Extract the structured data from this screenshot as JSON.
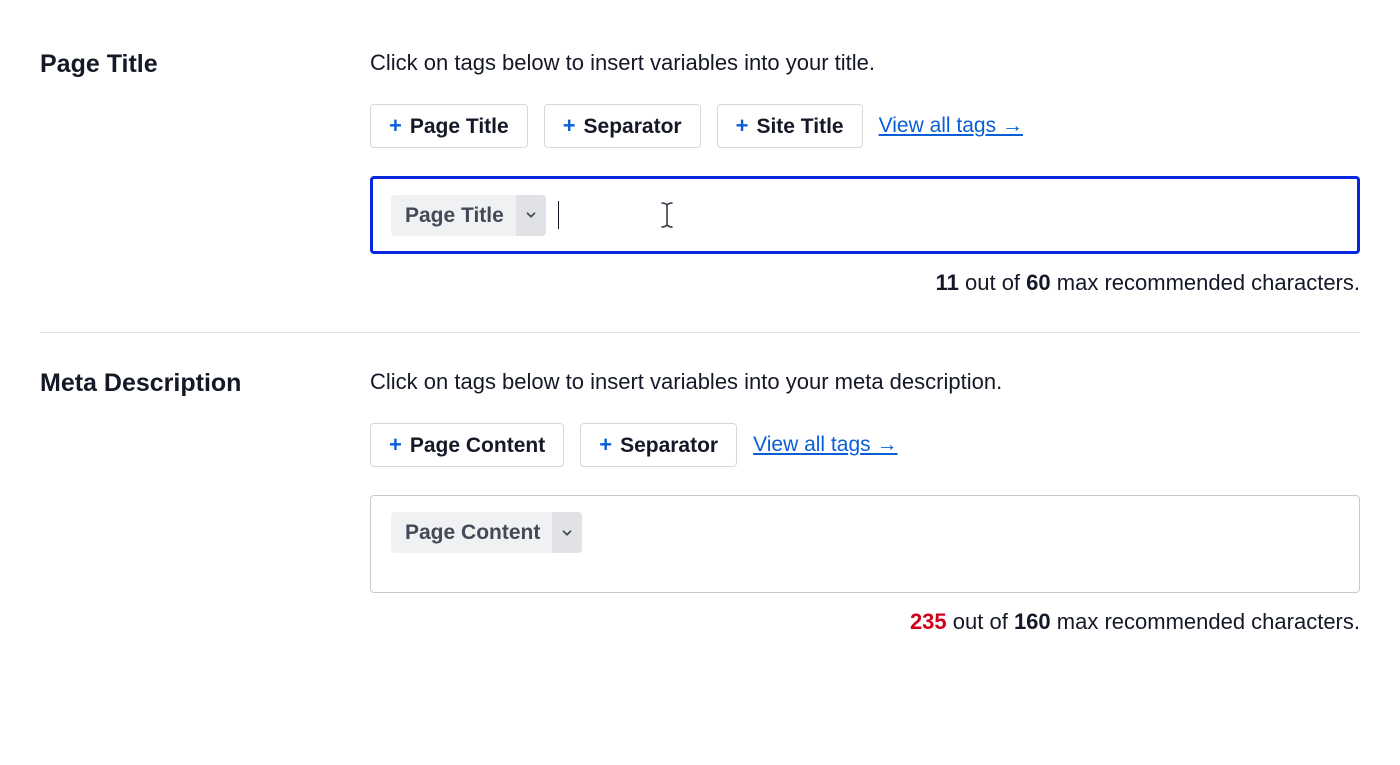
{
  "sections": {
    "page_title": {
      "heading": "Page Title",
      "instruction": "Click on tags below to insert variables into your title.",
      "tags": {
        "page_title": "Page Title",
        "separator": "Separator",
        "site_title": "Site Title"
      },
      "view_all": "View all tags →",
      "token_label": "Page Title",
      "counter": {
        "count": "11",
        "out_of": " out of ",
        "max": "60",
        "suffix": " max recommended characters.",
        "over_limit": false
      }
    },
    "meta_description": {
      "heading": "Meta Description",
      "instruction": "Click on tags below to insert variables into your meta description.",
      "tags": {
        "page_content": "Page Content",
        "separator": "Separator"
      },
      "view_all": "View all tags →",
      "token_label": "Page Content",
      "counter": {
        "count": "235",
        "out_of": " out of ",
        "max": "160",
        "suffix": " max recommended characters.",
        "over_limit": true
      }
    }
  },
  "icons": {
    "plus": "+"
  }
}
